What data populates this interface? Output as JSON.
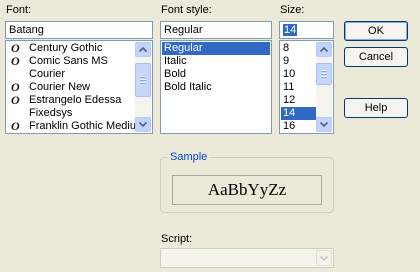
{
  "font": {
    "label": "Font:",
    "value": "Batang",
    "items": [
      {
        "name": "Century Gothic",
        "icon": "opentype-font-icon"
      },
      {
        "name": "Comic Sans MS",
        "icon": "opentype-font-icon"
      },
      {
        "name": "Courier",
        "icon": "none"
      },
      {
        "name": "Courier New",
        "icon": "opentype-font-icon"
      },
      {
        "name": "Estrangelo Edessa",
        "icon": "opentype-font-icon"
      },
      {
        "name": "Fixedsys",
        "icon": "none"
      },
      {
        "name": "Franklin Gothic Medium",
        "icon": "opentype-font-icon"
      }
    ],
    "icon_glyph": "O"
  },
  "style": {
    "label": "Font style:",
    "value": "Regular",
    "items": [
      "Regular",
      "Italic",
      "Bold",
      "Bold Italic"
    ],
    "selected_index": 0
  },
  "size": {
    "label": "Size:",
    "value": "14",
    "items": [
      "8",
      "9",
      "10",
      "11",
      "12",
      "14",
      "16"
    ],
    "selected_index": 5
  },
  "buttons": {
    "ok": "OK",
    "cancel": "Cancel",
    "help": "Help"
  },
  "sample": {
    "title": "Sample",
    "text": "AaBbYyZz"
  },
  "script": {
    "label": "Script:",
    "value": ""
  },
  "colors": {
    "dialog_bg": "#ece9d8",
    "selection": "#316ac5",
    "group_title": "#0046d5",
    "field_border": "#7f9db9"
  }
}
